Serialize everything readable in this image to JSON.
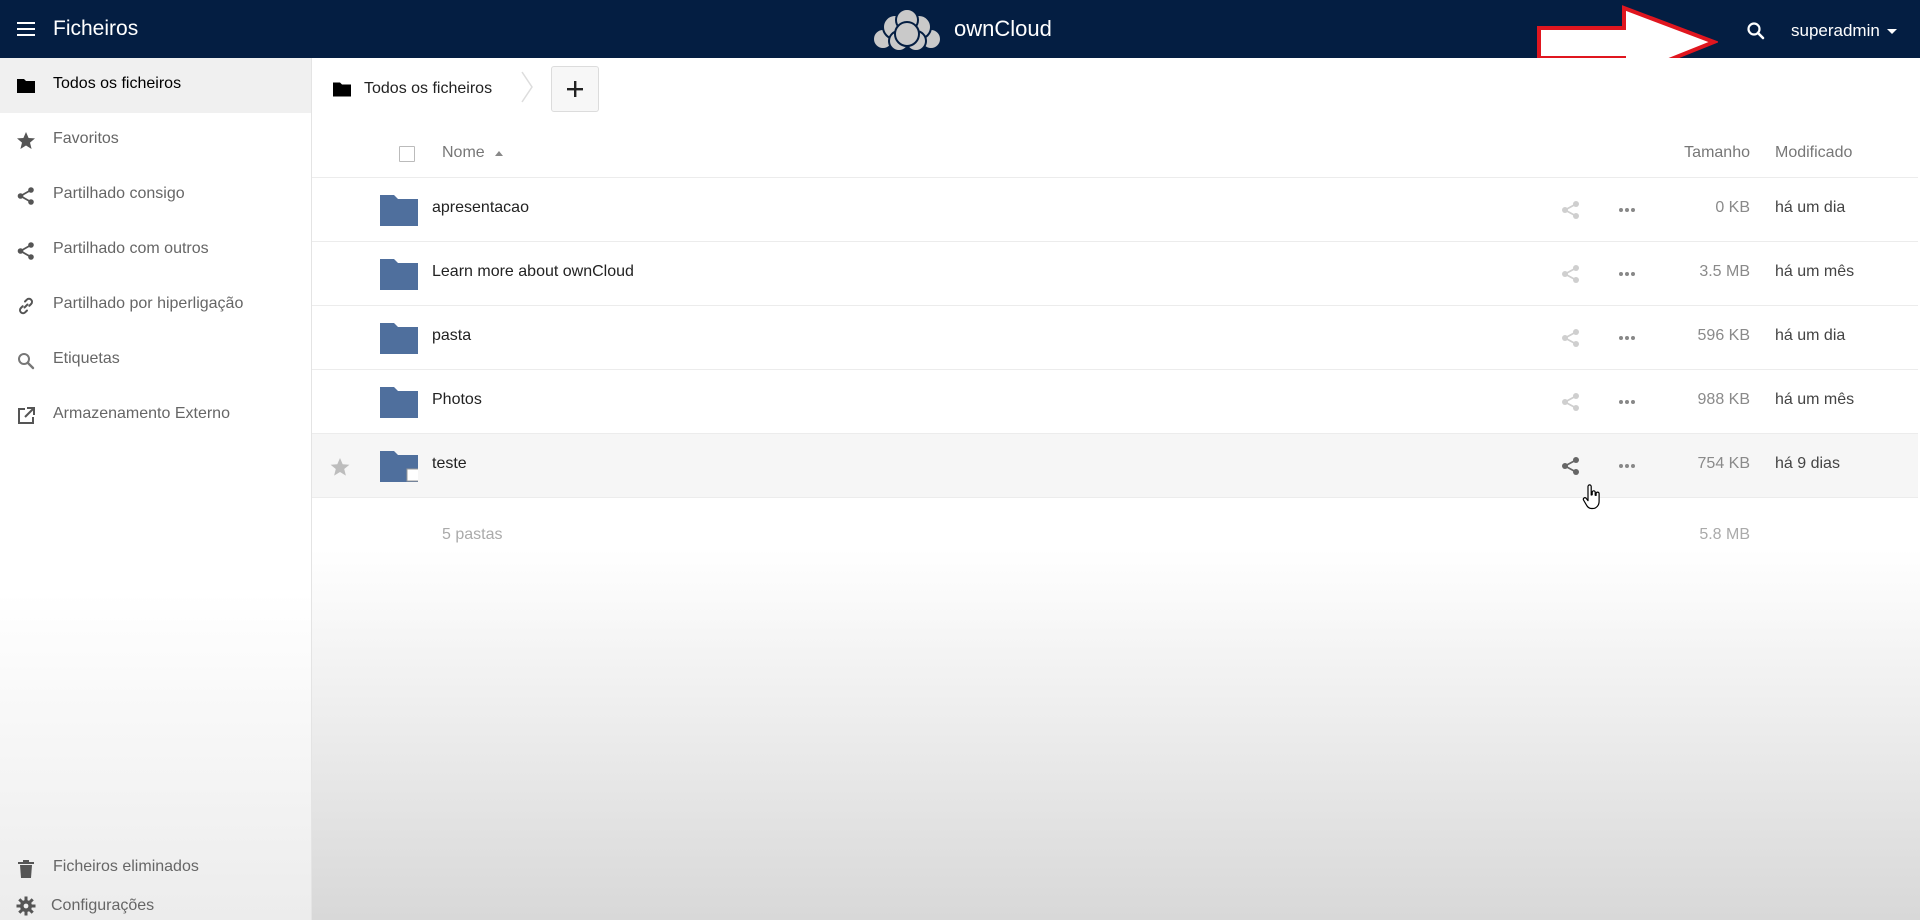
{
  "header": {
    "app_title": "Ficheiros",
    "logo_text": "ownCloud",
    "username": "superadmin",
    "background_color": "#041e42"
  },
  "sidebar": {
    "items": [
      {
        "label": "Todos os ficheiros",
        "icon": "folder-icon",
        "active": true
      },
      {
        "label": "Favoritos",
        "icon": "star-icon"
      },
      {
        "label": "Partilhado consigo",
        "icon": "share-icon"
      },
      {
        "label": "Partilhado com outros",
        "icon": "share-icon"
      },
      {
        "label": "Partilhado por hiperligação",
        "icon": "link-icon"
      },
      {
        "label": "Etiquetas",
        "icon": "tag-search-icon"
      },
      {
        "label": "Armazenamento Externo",
        "icon": "external-storage-icon"
      }
    ],
    "bottom": [
      {
        "label": "Ficheiros eliminados",
        "icon": "trash-icon"
      },
      {
        "label": "Configurações",
        "icon": "gear-icon"
      }
    ]
  },
  "breadcrumb": {
    "label": "Todos os ficheiros"
  },
  "table": {
    "headers": {
      "name": "Nome",
      "size": "Tamanho",
      "modified": "Modificado"
    },
    "rows": [
      {
        "name": "apresentacao",
        "size": "0 KB",
        "modified": "há um dia"
      },
      {
        "name": "Learn more about ownCloud",
        "size": "3.5 MB",
        "modified": "há um mês"
      },
      {
        "name": "pasta",
        "size": "596 KB",
        "modified": "há um dia"
      },
      {
        "name": "Photos",
        "size": "988 KB",
        "modified": "há um mês"
      },
      {
        "name": "teste",
        "size": "754 KB",
        "modified": "há 9 dias",
        "hovered": true
      }
    ],
    "summary": {
      "folders": "5 pastas",
      "size": "5.8 MB"
    }
  },
  "colors": {
    "folder": "#4f6f9d",
    "annotation_arrow": "#e0161f"
  }
}
